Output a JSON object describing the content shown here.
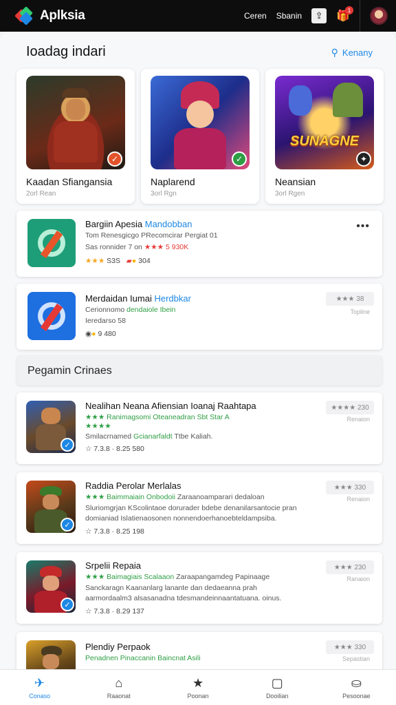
{
  "topbar": {
    "brand": "Aplksia",
    "links": [
      "Ceren",
      "Sbanin"
    ],
    "notification_count": "1"
  },
  "header": {
    "title": "Ioadag indari",
    "link": "Kenany"
  },
  "featured": [
    {
      "title": "Kaadan Sfiangansia",
      "sub": "2orl Rean"
    },
    {
      "title": "Naplarend",
      "sub": "3orl Rgn"
    },
    {
      "title": "Neansian",
      "sub": "3orl Rgen",
      "art_text": "SUNAGNE"
    }
  ],
  "apps": [
    {
      "name": "Bargiin Apesia",
      "name_link": "Mandobban",
      "line2": "Tom Renesgicgo P",
      "line2_link": "Recomcirar Pergiat 01",
      "line3": "Sas ronnider 7 on",
      "line3_rating": "★★★ 5",
      "line3_tail": " 930K",
      "rating_stars": "★★★",
      "rating_value": "S3S",
      "extra_value": "304"
    },
    {
      "name": "Merdaidan Iumai",
      "name_link": "Herdbkar",
      "line2": "Cerionnomo",
      "line2_link": "dendaiole Ibein",
      "line3": "Ieredarso 58",
      "line4_value": "9 480",
      "rating_box": "★★★ 38",
      "rating_sub": "Topline"
    }
  ],
  "section": {
    "title": "Pegamin Crinaes"
  },
  "games": [
    {
      "title": "Nealihan Neana Afiensian Ioanaj Raahtapa",
      "green": "★★★ Ranimagsomi Oteaneadran Sbt Star A",
      "stars2": "★★★★",
      "desc": "Smilacrnamed",
      "desc_green": "Gcianarfaldt",
      "desc_tail": "Ttbe Kaliah.",
      "meta": "☆ 7.3.8 · 8.25 580",
      "rating_box": "★★★★ 230",
      "rating_sub": "Renaion"
    },
    {
      "title": "Raddia Perolar Merlalas",
      "green": "★★★ Baimmaiain Onbodoii",
      "green_tail": " Zaraanoamparari dedaloan",
      "desc": "Sluriomgrjan KScolintaoe dorurader bdebe denanilarsantocie pran",
      "desc2": "domianiad Islatienaosonen nonnendoerhanoebteldampsiba.",
      "meta": "☆ 7.3.8 · 8.25 198",
      "rating_box": "★★★ 330",
      "rating_sub": "Renaion"
    },
    {
      "title": "Srpelii Repaia",
      "green": "★★★ Baimagiais Scalaaon",
      "green_tail": " Zaraapangamdeg Papinaage",
      "desc": "Sanckaragn Kaananlarg lanante dan dedaeanna prah",
      "desc2": "aarmordaalm3 alsasanadna tdesmandeinnaantatuana. oinus.",
      "meta": "☆ 7.3.8 · 8.29 137",
      "rating_box": "★★★ 230",
      "rating_sub": "Ranaion"
    },
    {
      "title": "Plendiy Perpaok",
      "green": "Penadnen Pinaccanin",
      "green_tail": " Baincnat Asili",
      "rating_box": "★★★ 330",
      "rating_sub": "Sepastian"
    }
  ],
  "bottomnav": [
    {
      "label": "Conaso",
      "icon": "✈"
    },
    {
      "label": "Raaonat",
      "icon": "⌂"
    },
    {
      "label": "Poonan",
      "icon": "★"
    },
    {
      "label": "Dooilian",
      "icon": "▢"
    },
    {
      "label": "Pesoonae",
      "icon": "⛀"
    }
  ],
  "colors": {
    "accent": "#1e88e5",
    "topbar": "#0d0d0e",
    "star": "#f5a623",
    "green": "#2e9e44"
  }
}
